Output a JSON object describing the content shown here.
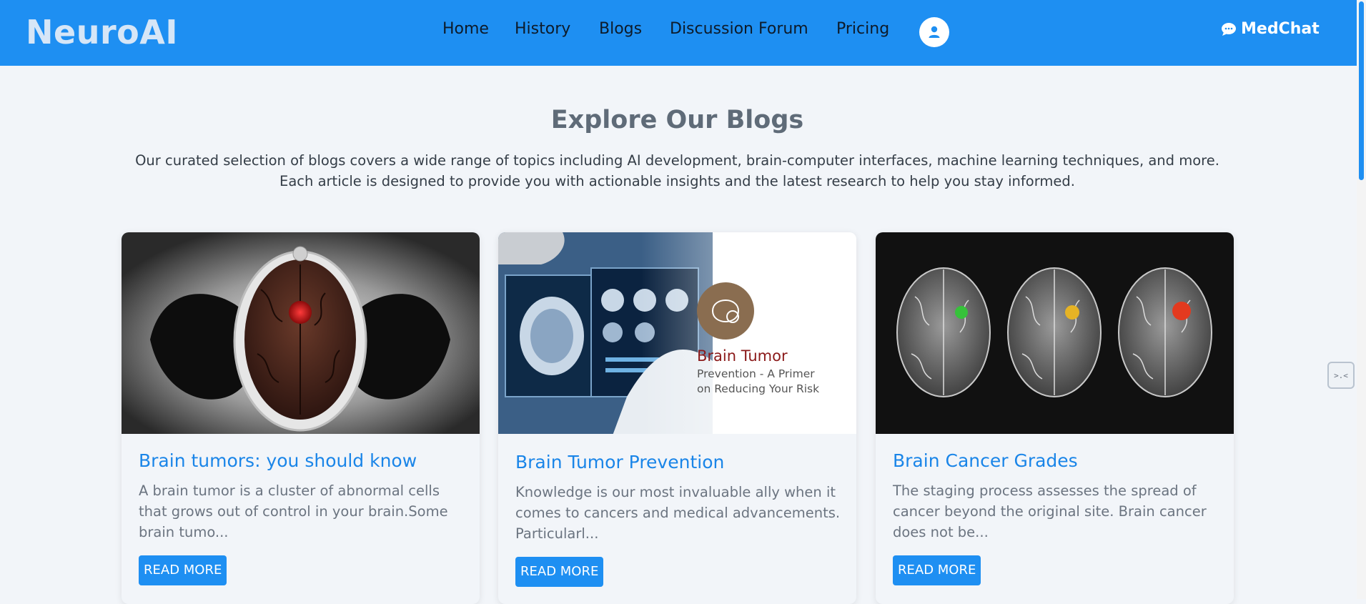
{
  "navbar": {
    "brand": "NeuroAI",
    "links": [
      "Home",
      "History",
      "Blogs",
      "Discussion Forum",
      "Pricing"
    ],
    "medchat_label": "MedChat",
    "accent_color": "#1e8ff2",
    "avatar_icon": "user-icon",
    "medchat_icon": "chat-bubble-icon"
  },
  "main": {
    "title": "Explore Our Blogs",
    "intro": "Our curated selection of blogs covers a wide range of topics including AI development, brain-computer interfaces, machine learning techniques, and more. Each article is designed to provide you with actionable insights and the latest research to help you stay informed."
  },
  "cards": [
    {
      "title": "Brain tumors: you should know",
      "excerpt": "A brain tumor is a cluster of abnormal cells that grows out of control in your brain.Some brain tumo...",
      "button": "READ MORE"
    },
    {
      "title": "Brain Tumor Prevention",
      "excerpt": "Knowledge is our most invaluable ally when it comes to cancers and medical advancements. Particularl...",
      "button": "READ MORE",
      "image_text": {
        "heading": "Brain Tumor",
        "line1": "Prevention - A Primer",
        "line2": "on Reducing Your Risk"
      }
    },
    {
      "title": "Brain Cancer Grades",
      "excerpt": "The staging process assesses the spread of cancer beyond the original site. Brain cancer does not be...",
      "button": "READ MORE"
    }
  ],
  "side_widget": {
    "icon": "code-widget-icon",
    "glyph": ">.<"
  }
}
